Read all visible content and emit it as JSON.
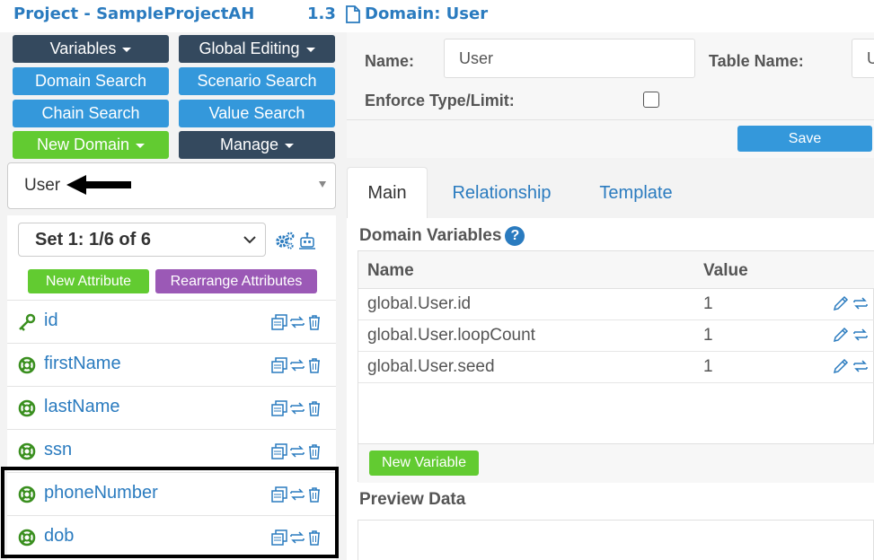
{
  "header": {
    "project_title": "Project - SampleProjectAH",
    "version": "1.3",
    "domain_title": "Domain: User"
  },
  "toolbar": {
    "variables": "Variables",
    "global_editing": "Global Editing",
    "domain_search": "Domain Search",
    "scenario_search": "Scenario Search",
    "chain_search": "Chain Search",
    "value_search": "Value Search",
    "new_domain": "New Domain",
    "manage": "Manage"
  },
  "domain_select": {
    "value": "User"
  },
  "attributes": {
    "set_label": "Set 1: 1/6 of 6",
    "new_attribute": "New Attribute",
    "rearrange": "Rearrange Attributes",
    "items": [
      {
        "name": "id",
        "icon": "key-icon"
      },
      {
        "name": "firstName",
        "icon": "lifebuoy-icon"
      },
      {
        "name": "lastName",
        "icon": "lifebuoy-icon"
      },
      {
        "name": "ssn",
        "icon": "lifebuoy-icon"
      },
      {
        "name": "phoneNumber",
        "icon": "lifebuoy-icon"
      },
      {
        "name": "dob",
        "icon": "lifebuoy-icon"
      }
    ]
  },
  "form": {
    "name_label": "Name:",
    "name_value": "User",
    "table_name_label": "Table Name:",
    "table_name_value": "User",
    "enforce_label": "Enforce Type/Limit:",
    "enforce_checked": false,
    "save": "Save"
  },
  "tabs": [
    "Main",
    "Relationship",
    "Template"
  ],
  "domain_variables": {
    "title": "Domain Variables",
    "help": "?",
    "col_name": "Name",
    "col_value": "Value",
    "rows": [
      {
        "name": "global.User.id",
        "value": "1"
      },
      {
        "name": "global.User.loopCount",
        "value": "1"
      },
      {
        "name": "global.User.seed",
        "value": "1"
      }
    ],
    "new_variable": "New Variable"
  },
  "preview": {
    "title": "Preview Data"
  },
  "colors": {
    "dark": "#34495e",
    "blue": "#3498db",
    "green": "#62cb31",
    "purple": "#9b59b6",
    "link": "#2a7bbf",
    "attr_icon": "#3a8f1f"
  }
}
